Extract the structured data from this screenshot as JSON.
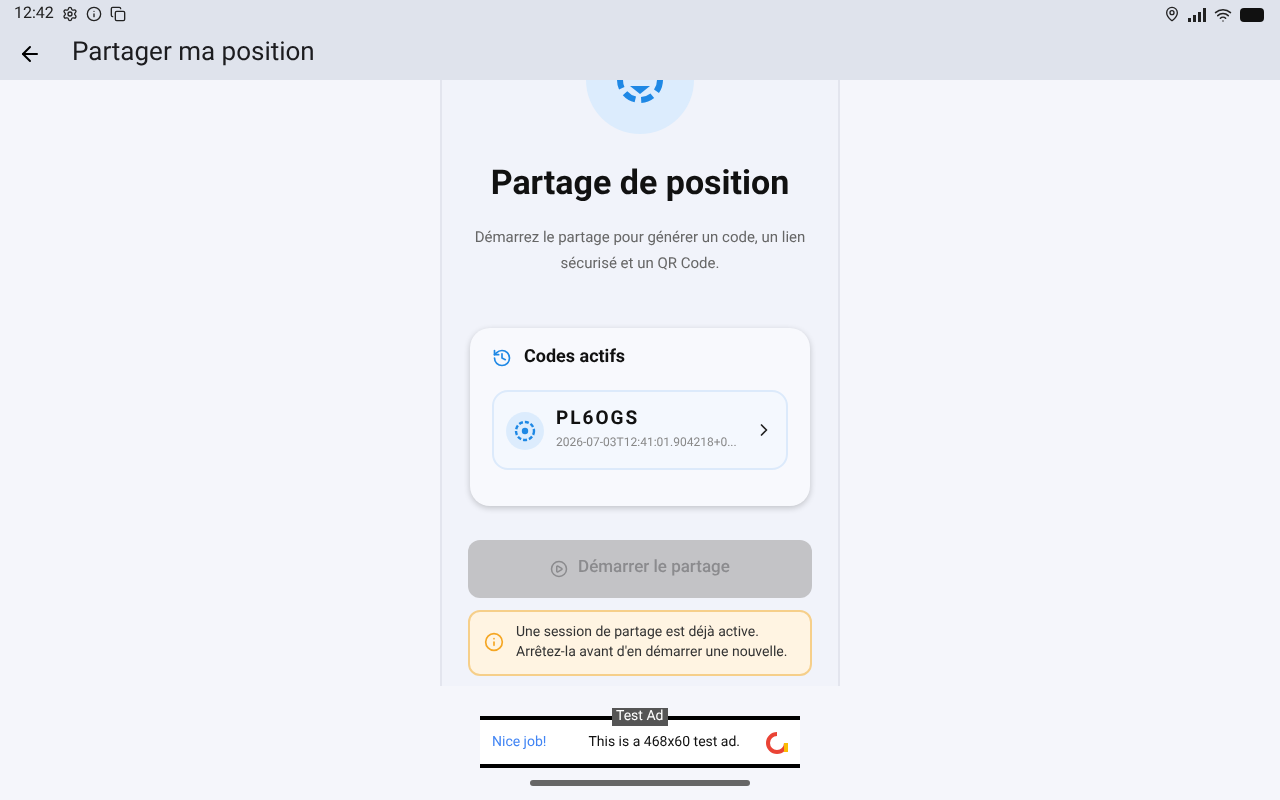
{
  "status_bar": {
    "time": "12:42"
  },
  "app_bar": {
    "title": "Partager ma position"
  },
  "main": {
    "title": "Partage de position",
    "description": "Démarrez le partage pour générer un code, un lien sécurisé et un QR Code."
  },
  "active_codes": {
    "title": "Codes actifs",
    "items": [
      {
        "code": "PL6OGS",
        "timestamp": "2026-07-03T12:41:01.904218+0..."
      }
    ]
  },
  "start_button": {
    "label": "Démarrer le partage",
    "disabled": true
  },
  "warning": {
    "text": "Une session de partage est déjà active. Arrêtez-la avant d'en démarrer une nouvelle."
  },
  "ad": {
    "badge": "Test Ad",
    "link": "Nice job!",
    "text": "This is a 468x60 test ad."
  }
}
